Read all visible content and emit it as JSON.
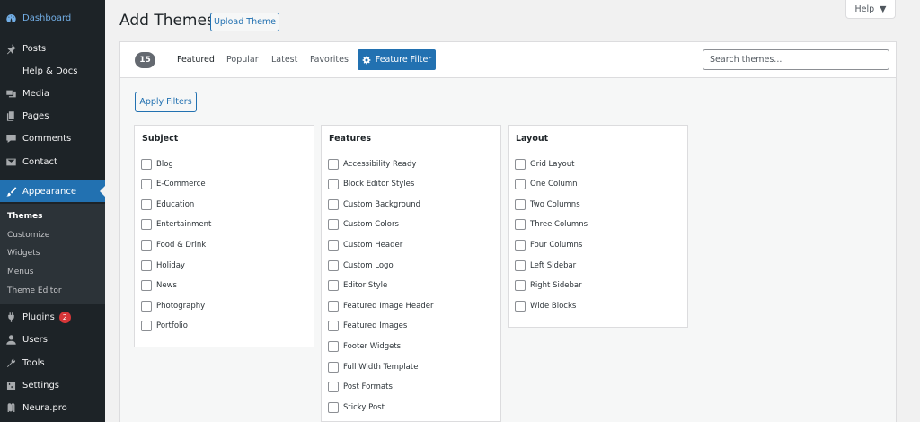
{
  "sidebar": {
    "items": [
      {
        "label": "Dashboard",
        "icon": "dashboard-icon"
      },
      {
        "label": "Posts",
        "icon": "pin-icon"
      },
      {
        "label": "Help & Docs",
        "icon": ""
      },
      {
        "label": "Media",
        "icon": "media-icon"
      },
      {
        "label": "Pages",
        "icon": "pages-icon"
      },
      {
        "label": "Comments",
        "icon": "comment-icon"
      },
      {
        "label": "Contact",
        "icon": "mail-icon"
      },
      {
        "label": "Appearance",
        "icon": "brush-icon"
      },
      {
        "label": "Plugins",
        "icon": "plugin-icon",
        "badge": "2"
      },
      {
        "label": "Users",
        "icon": "users-icon"
      },
      {
        "label": "Tools",
        "icon": "wrench-icon"
      },
      {
        "label": "Settings",
        "icon": "settings-icon"
      },
      {
        "label": "Neura.pro",
        "icon": "neura-icon"
      }
    ],
    "submenu": [
      "Themes",
      "Customize",
      "Widgets",
      "Menus",
      "Theme Editor"
    ]
  },
  "header": {
    "title": "Add Themes",
    "upload_label": "Upload Theme",
    "help_label": "Help"
  },
  "filter_bar": {
    "count": "15",
    "tabs": [
      "Featured",
      "Popular",
      "Latest",
      "Favorites"
    ],
    "feature_filter_label": "Feature Filter",
    "search_placeholder": "Search themes..."
  },
  "drawer": {
    "apply_label": "Apply Filters",
    "groups": [
      {
        "title": "Subject",
        "options": [
          "Blog",
          "E-Commerce",
          "Education",
          "Entertainment",
          "Food & Drink",
          "Holiday",
          "News",
          "Photography",
          "Portfolio"
        ]
      },
      {
        "title": "Features",
        "options": [
          "Accessibility Ready",
          "Block Editor Styles",
          "Custom Background",
          "Custom Colors",
          "Custom Header",
          "Custom Logo",
          "Editor Style",
          "Featured Image Header",
          "Featured Images",
          "Footer Widgets",
          "Full Width Template",
          "Post Formats",
          "Sticky Post"
        ]
      },
      {
        "title": "Layout",
        "options": [
          "Grid Layout",
          "One Column",
          "Two Columns",
          "Three Columns",
          "Four Columns",
          "Left Sidebar",
          "Right Sidebar",
          "Wide Blocks"
        ]
      }
    ]
  },
  "colors": {
    "accent": "#2271b1",
    "sidebar": "#1d2327",
    "badge": "#d63638"
  }
}
